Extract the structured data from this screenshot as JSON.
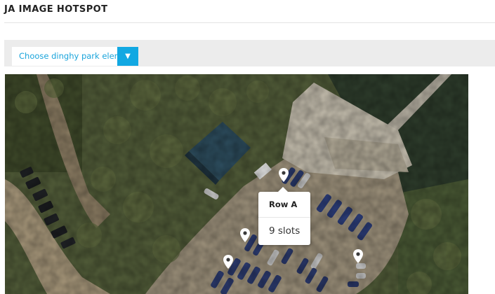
{
  "module": {
    "title": "JA IMAGE HOTSPOT"
  },
  "filter": {
    "selected": "Choose dinghy park element",
    "arrow_icon": "triangle-down"
  },
  "tooltip": {
    "title": "Row A",
    "body": "9 slots"
  },
  "pins": [
    {
      "id": "pin-row-a",
      "icon": "map-marker"
    },
    {
      "id": "pin-2",
      "icon": "map-marker"
    },
    {
      "id": "pin-3",
      "icon": "map-marker"
    },
    {
      "id": "pin-4",
      "icon": "map-marker"
    }
  ],
  "colors": {
    "accent": "#12a8e2",
    "toolbar": "#ececec",
    "pin": "#ffffff"
  }
}
